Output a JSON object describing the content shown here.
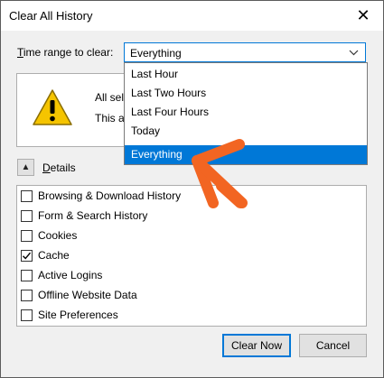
{
  "dialog": {
    "title": "Clear All History",
    "close_glyph": "✕"
  },
  "time_range": {
    "label_accel": "T",
    "label_rest": "ime range to clear:",
    "selected": "Everything",
    "options": [
      "Last Hour",
      "Last Two Hours",
      "Last Four Hours",
      "Today",
      "Everything"
    ]
  },
  "warning": {
    "line1": "All sele",
    "line2": "This ac"
  },
  "details": {
    "label_accel": "D",
    "label_rest": "etails",
    "toggle_glyph": "▲",
    "items": [
      {
        "label": "Browsing & Download History",
        "checked": false
      },
      {
        "label": "Form & Search History",
        "checked": false
      },
      {
        "label": "Cookies",
        "checked": false
      },
      {
        "label": "Cache",
        "checked": true
      },
      {
        "label": "Active Logins",
        "checked": false
      },
      {
        "label": "Offline Website Data",
        "checked": false
      },
      {
        "label": "Site Preferences",
        "checked": false
      }
    ]
  },
  "buttons": {
    "clear_now": "Clear Now",
    "cancel": "Cancel"
  },
  "colors": {
    "accent": "#0078d7",
    "arrow": "#f26522",
    "warning_yellow": "#f5c400"
  }
}
